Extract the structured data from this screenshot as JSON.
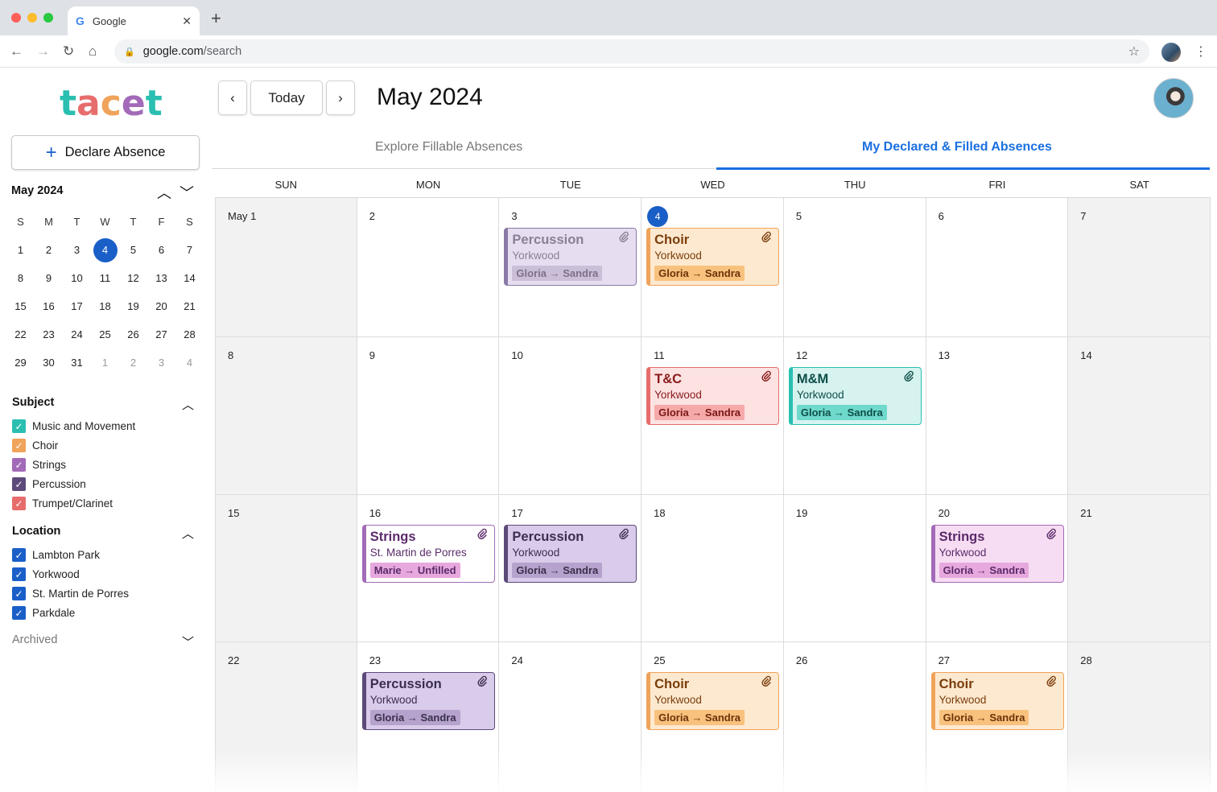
{
  "browser": {
    "tab_title": "Google",
    "tab_icon": "G",
    "url_host": "google.com",
    "url_path": "/search"
  },
  "app": {
    "logo": "tacet",
    "declare_label": "Declare Absence",
    "month_title": "May 2024",
    "today_label": "Today"
  },
  "tabs": {
    "explore": "Explore Fillable Absences",
    "mine": "My Declared & Filled Absences"
  },
  "mini": {
    "title": "May 2024",
    "dows": [
      "S",
      "M",
      "T",
      "W",
      "T",
      "F",
      "S"
    ],
    "weeks": [
      [
        "1",
        "2",
        "3",
        "4",
        "5",
        "6",
        "7"
      ],
      [
        "8",
        "9",
        "10",
        "11",
        "12",
        "13",
        "14"
      ],
      [
        "15",
        "16",
        "17",
        "18",
        "19",
        "20",
        "21"
      ],
      [
        "22",
        "23",
        "24",
        "25",
        "26",
        "27",
        "28"
      ],
      [
        "29",
        "30",
        "31",
        "1",
        "2",
        "3",
        "4"
      ]
    ],
    "selected": "4"
  },
  "subject": {
    "title": "Subject",
    "items": [
      {
        "label": "Music and Movement",
        "color": "#2bbfb1"
      },
      {
        "label": "Choir",
        "color": "#f0a35a"
      },
      {
        "label": "Strings",
        "color": "#a26ab8"
      },
      {
        "label": "Percussion",
        "color": "#5c4b7a"
      },
      {
        "label": "Trumpet/Clarinet",
        "color": "#e76d6d"
      }
    ]
  },
  "location": {
    "title": "Location",
    "items": [
      {
        "label": "Lambton Park"
      },
      {
        "label": "Yorkwood"
      },
      {
        "label": "St. Martin de Porres"
      },
      {
        "label": "Parkdale"
      }
    ],
    "color": "#1a5fc8"
  },
  "archived": "Archived",
  "calendar": {
    "dows": [
      "SUN",
      "MON",
      "TUE",
      "WED",
      "THU",
      "FRI",
      "SAT"
    ],
    "days": [
      "May 1",
      "2",
      "3",
      "4",
      "5",
      "6",
      "7",
      "8",
      "9",
      "10",
      "11",
      "12",
      "13",
      "14",
      "15",
      "16",
      "17",
      "18",
      "19",
      "20",
      "21",
      "22",
      "23",
      "24",
      "25",
      "26",
      "27",
      "28"
    ],
    "today": "4",
    "events": {
      "e3": {
        "title": "Percussion",
        "location": "Yorkwood",
        "who": "Gloria → Sandra"
      },
      "e4": {
        "title": "Choir",
        "location": "Yorkwood",
        "who": "Gloria → Sandra"
      },
      "e11": {
        "title": "T&C",
        "location": "Yorkwood",
        "who": "Gloria → Sandra"
      },
      "e12": {
        "title": "M&M",
        "location": "Yorkwood",
        "who": "Gloria → Sandra"
      },
      "e16": {
        "title": "Strings",
        "location": "St. Martin de Porres",
        "who": "Marie → Unfilled"
      },
      "e17": {
        "title": "Percussion",
        "location": "Yorkwood",
        "who": "Gloria → Sandra"
      },
      "e20": {
        "title": "Strings",
        "location": "Yorkwood",
        "who": "Gloria → Sandra"
      },
      "e23": {
        "title": "Percussion",
        "location": "Yorkwood",
        "who": "Gloria → Sandra"
      },
      "e25": {
        "title": "Choir",
        "location": "Yorkwood",
        "who": "Gloria → Sandra"
      },
      "e27": {
        "title": "Choir",
        "location": "Yorkwood",
        "who": "Gloria → Sandra"
      }
    }
  }
}
